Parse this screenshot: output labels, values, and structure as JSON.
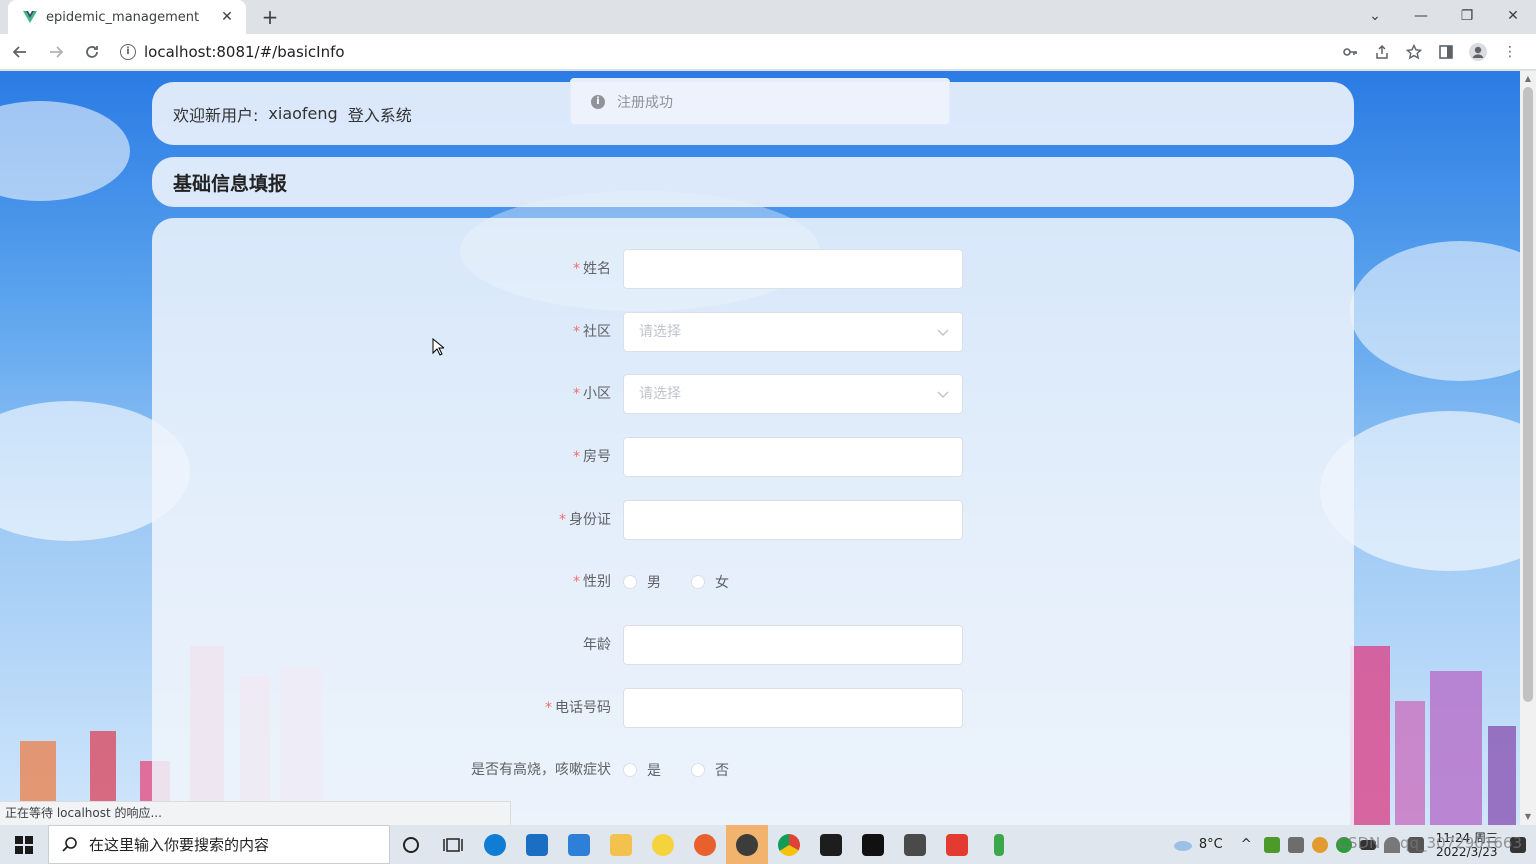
{
  "browser": {
    "tab_title": "epidemic_management",
    "url": "localhost:8081/#/basicInfo",
    "status_text": "正在等待 localhost 的响应..."
  },
  "page": {
    "welcome_prefix": "欢迎新用户:",
    "username": "xiaofeng",
    "welcome_suffix": "登入系统",
    "section_title": "基础信息填报",
    "toast_message": "注册成功"
  },
  "form": {
    "name_label": "姓名",
    "community_label": "社区",
    "community_placeholder": "请选择",
    "estate_label": "小区",
    "estate_placeholder": "请选择",
    "room_label": "房号",
    "id_label": "身份证",
    "gender_label": "性别",
    "gender_options": [
      "男",
      "女"
    ],
    "age_label": "年龄",
    "phone_label": "电话号码",
    "fever_label": "是否有高烧，咳嗽症状",
    "fever_options": [
      "是",
      "否"
    ]
  },
  "taskbar": {
    "search_placeholder": "在这里输入你要搜索的内容",
    "temperature": "8°C",
    "time": "11:24 周三",
    "date": "2022/3/23",
    "watermark": "CSDN @qq_3072901663"
  },
  "colors": {
    "required": "#f56c6c",
    "label": "#606266",
    "placeholder": "#c0c4cc",
    "sky_top": "#2a7be4"
  }
}
